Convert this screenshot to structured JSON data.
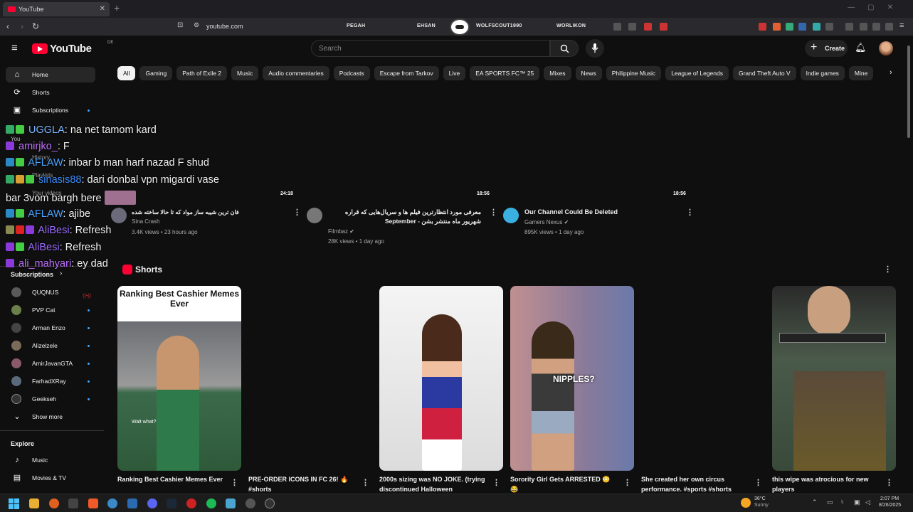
{
  "browser": {
    "tab_title": "YouTube",
    "url": "youtube.com",
    "twitch_names": [
      "PEGAH",
      "EHSAN",
      "WOLFSCOUT1990",
      "WORLIKON"
    ]
  },
  "header": {
    "logo_text": "YouTube",
    "country_code": "DE",
    "search_placeholder": "Search",
    "create_label": "Create"
  },
  "chips": [
    "All",
    "Gaming",
    "Path of Exile 2",
    "Music",
    "Audio commentaries",
    "Podcasts",
    "Escape from Tarkov",
    "Live",
    "EA SPORTS FC™ 25",
    "Mixes",
    "News",
    "Philippine Music",
    "League of Legends",
    "Grand Theft Auto V",
    "Indie games",
    "Mine"
  ],
  "sidebar": {
    "main": [
      {
        "label": "Home",
        "icon": "home-icon"
      },
      {
        "label": "Shorts",
        "icon": "shorts-icon"
      },
      {
        "label": "Subscriptions",
        "icon": "subscriptions-icon"
      }
    ],
    "you_items": [
      "You",
      "History",
      "Playlists",
      "Your videos"
    ],
    "subscriptions_heading": "Subscriptions",
    "subscriptions": [
      {
        "name": "QUQNUS",
        "color": "#5a5a5a"
      },
      {
        "name": "PVP Cat",
        "color": "#6a7f4a"
      },
      {
        "name": "Arman Enzo",
        "color": "#444"
      },
      {
        "name": "Alizelzele",
        "color": "#7a6a5a"
      },
      {
        "name": "AmirJavanGTA",
        "color": "#8a5a6a"
      },
      {
        "name": "FarhadXRay",
        "color": "#5a6a7a"
      },
      {
        "name": "Geekseh",
        "color": "#333"
      }
    ],
    "show_more": "Show more",
    "explore_heading": "Explore",
    "explore": [
      "Music",
      "Movies & TV"
    ]
  },
  "chat": [
    {
      "user": "UGGLA",
      "msg": "na net tamom kard",
      "color": "#7fb6ff"
    },
    {
      "user": "amirjko_",
      "msg": "F",
      "color": "#c070ff"
    },
    {
      "user": "AFLAW",
      "msg": "inbar b man harf nazad F shud",
      "color": "#4aa3ff"
    },
    {
      "user": "sinasis88",
      "msg": "dari donbal vpn migardi vase",
      "color": "#3a8cff"
    },
    {
      "user": "",
      "msg": "bar 3vom bargh bere",
      "color": "#fff"
    },
    {
      "user": "AFLAW",
      "msg": "ajibe",
      "color": "#4aa3ff"
    },
    {
      "user": "AliBesi",
      "msg": "Refresh",
      "color": "#9b6cff"
    },
    {
      "user": "AliBesi",
      "msg": "Refresh",
      "color": "#9b6cff"
    },
    {
      "user": "ali_mahyari",
      "msg": "ey dad",
      "color": "#c070ff"
    }
  ],
  "videos": [
    {
      "duration": "24:18",
      "title": "فان ترین شیبه ساز مواد که تا حالا ساخته شده",
      "channel": "Sina Crash",
      "meta": "3.4K views • 23 hours ago",
      "avatar_color": "#6a6a7a"
    },
    {
      "duration": "18:56",
      "title": "معرفی مورد انتظارترین فیلم ها و سریال‌هایی که قراره شهریور ماه منتشر بشن - September",
      "channel": "Filmbaz",
      "meta": "28K views • 1 day ago",
      "avatar_color": "#777"
    },
    {
      "duration": "18:56",
      "title": "Our Channel Could Be Deleted",
      "channel": "Gamers Nexus",
      "meta": "895K views • 1 day ago",
      "avatar_color": "#3ab0e0"
    }
  ],
  "shorts_heading": "Shorts",
  "shorts": [
    {
      "title": "Ranking Best Cashier Memes Ever",
      "overlay": "Ranking Best Cashier Memes Ever",
      "caption": "Wait what?"
    },
    {
      "title": "PRE-ORDER ICONS IN FC 26! 🔥 #shorts"
    },
    {
      "title": "2000s sizing was NO JOKE. (trying discontinued Halloween"
    },
    {
      "title": "Sorority Girl Gets ARRESTED 😳😂",
      "overlay": "NIPPLES?"
    },
    {
      "title": "She created her own circus performance. #sports #shorts"
    },
    {
      "title": "this wipe was atrocious for new players"
    }
  ],
  "taskbar": {
    "temp": "36°C",
    "weather": "Sunny",
    "time": "2:07 PM",
    "date": "8/26/2025"
  }
}
